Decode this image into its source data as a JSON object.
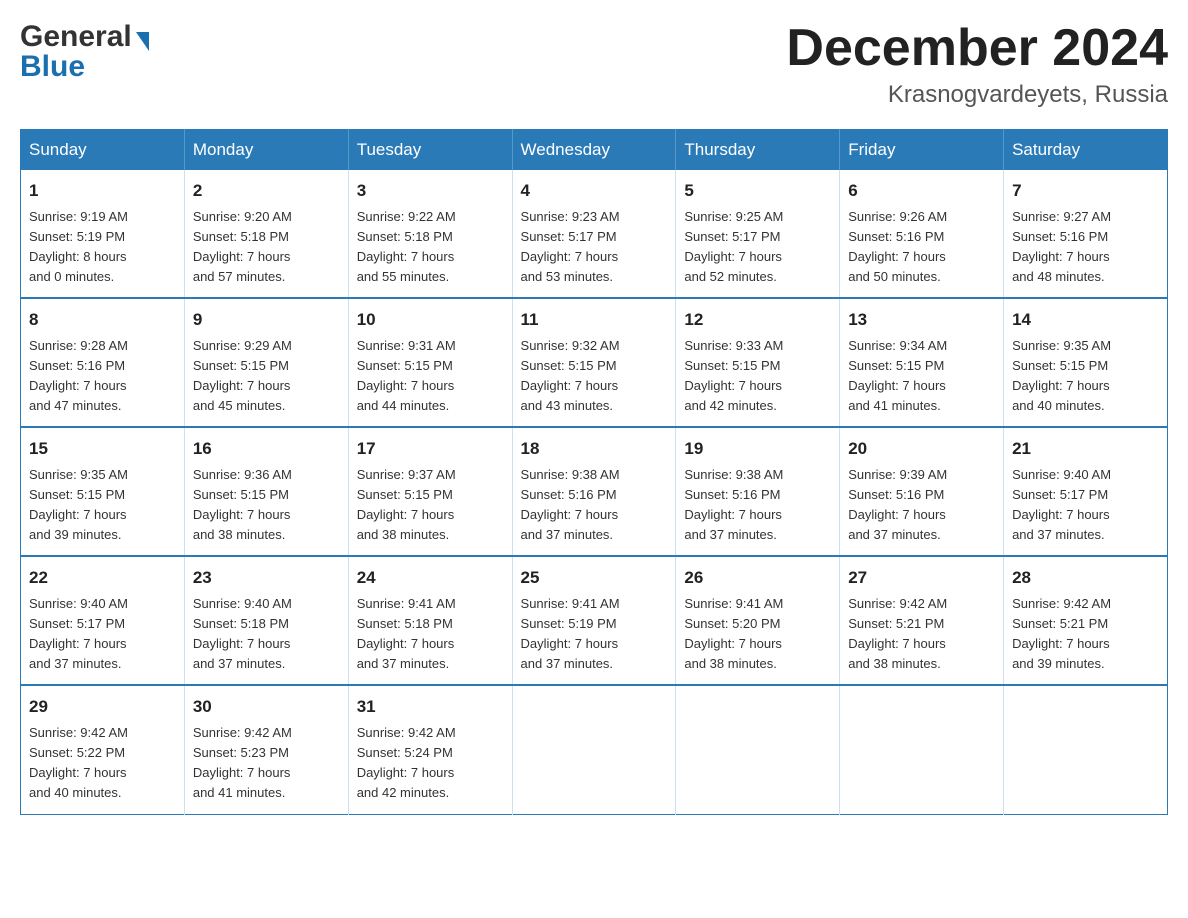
{
  "header": {
    "logo_general": "General",
    "logo_blue": "Blue",
    "title": "December 2024",
    "subtitle": "Krasnogvardeyets, Russia"
  },
  "weekdays": [
    "Sunday",
    "Monday",
    "Tuesday",
    "Wednesday",
    "Thursday",
    "Friday",
    "Saturday"
  ],
  "weeks": [
    [
      {
        "day": "1",
        "info": "Sunrise: 9:19 AM\nSunset: 5:19 PM\nDaylight: 8 hours\nand 0 minutes."
      },
      {
        "day": "2",
        "info": "Sunrise: 9:20 AM\nSunset: 5:18 PM\nDaylight: 7 hours\nand 57 minutes."
      },
      {
        "day": "3",
        "info": "Sunrise: 9:22 AM\nSunset: 5:18 PM\nDaylight: 7 hours\nand 55 minutes."
      },
      {
        "day": "4",
        "info": "Sunrise: 9:23 AM\nSunset: 5:17 PM\nDaylight: 7 hours\nand 53 minutes."
      },
      {
        "day": "5",
        "info": "Sunrise: 9:25 AM\nSunset: 5:17 PM\nDaylight: 7 hours\nand 52 minutes."
      },
      {
        "day": "6",
        "info": "Sunrise: 9:26 AM\nSunset: 5:16 PM\nDaylight: 7 hours\nand 50 minutes."
      },
      {
        "day": "7",
        "info": "Sunrise: 9:27 AM\nSunset: 5:16 PM\nDaylight: 7 hours\nand 48 minutes."
      }
    ],
    [
      {
        "day": "8",
        "info": "Sunrise: 9:28 AM\nSunset: 5:16 PM\nDaylight: 7 hours\nand 47 minutes."
      },
      {
        "day": "9",
        "info": "Sunrise: 9:29 AM\nSunset: 5:15 PM\nDaylight: 7 hours\nand 45 minutes."
      },
      {
        "day": "10",
        "info": "Sunrise: 9:31 AM\nSunset: 5:15 PM\nDaylight: 7 hours\nand 44 minutes."
      },
      {
        "day": "11",
        "info": "Sunrise: 9:32 AM\nSunset: 5:15 PM\nDaylight: 7 hours\nand 43 minutes."
      },
      {
        "day": "12",
        "info": "Sunrise: 9:33 AM\nSunset: 5:15 PM\nDaylight: 7 hours\nand 42 minutes."
      },
      {
        "day": "13",
        "info": "Sunrise: 9:34 AM\nSunset: 5:15 PM\nDaylight: 7 hours\nand 41 minutes."
      },
      {
        "day": "14",
        "info": "Sunrise: 9:35 AM\nSunset: 5:15 PM\nDaylight: 7 hours\nand 40 minutes."
      }
    ],
    [
      {
        "day": "15",
        "info": "Sunrise: 9:35 AM\nSunset: 5:15 PM\nDaylight: 7 hours\nand 39 minutes."
      },
      {
        "day": "16",
        "info": "Sunrise: 9:36 AM\nSunset: 5:15 PM\nDaylight: 7 hours\nand 38 minutes."
      },
      {
        "day": "17",
        "info": "Sunrise: 9:37 AM\nSunset: 5:15 PM\nDaylight: 7 hours\nand 38 minutes."
      },
      {
        "day": "18",
        "info": "Sunrise: 9:38 AM\nSunset: 5:16 PM\nDaylight: 7 hours\nand 37 minutes."
      },
      {
        "day": "19",
        "info": "Sunrise: 9:38 AM\nSunset: 5:16 PM\nDaylight: 7 hours\nand 37 minutes."
      },
      {
        "day": "20",
        "info": "Sunrise: 9:39 AM\nSunset: 5:16 PM\nDaylight: 7 hours\nand 37 minutes."
      },
      {
        "day": "21",
        "info": "Sunrise: 9:40 AM\nSunset: 5:17 PM\nDaylight: 7 hours\nand 37 minutes."
      }
    ],
    [
      {
        "day": "22",
        "info": "Sunrise: 9:40 AM\nSunset: 5:17 PM\nDaylight: 7 hours\nand 37 minutes."
      },
      {
        "day": "23",
        "info": "Sunrise: 9:40 AM\nSunset: 5:18 PM\nDaylight: 7 hours\nand 37 minutes."
      },
      {
        "day": "24",
        "info": "Sunrise: 9:41 AM\nSunset: 5:18 PM\nDaylight: 7 hours\nand 37 minutes."
      },
      {
        "day": "25",
        "info": "Sunrise: 9:41 AM\nSunset: 5:19 PM\nDaylight: 7 hours\nand 37 minutes."
      },
      {
        "day": "26",
        "info": "Sunrise: 9:41 AM\nSunset: 5:20 PM\nDaylight: 7 hours\nand 38 minutes."
      },
      {
        "day": "27",
        "info": "Sunrise: 9:42 AM\nSunset: 5:21 PM\nDaylight: 7 hours\nand 38 minutes."
      },
      {
        "day": "28",
        "info": "Sunrise: 9:42 AM\nSunset: 5:21 PM\nDaylight: 7 hours\nand 39 minutes."
      }
    ],
    [
      {
        "day": "29",
        "info": "Sunrise: 9:42 AM\nSunset: 5:22 PM\nDaylight: 7 hours\nand 40 minutes."
      },
      {
        "day": "30",
        "info": "Sunrise: 9:42 AM\nSunset: 5:23 PM\nDaylight: 7 hours\nand 41 minutes."
      },
      {
        "day": "31",
        "info": "Sunrise: 9:42 AM\nSunset: 5:24 PM\nDaylight: 7 hours\nand 42 minutes."
      },
      {
        "day": "",
        "info": ""
      },
      {
        "day": "",
        "info": ""
      },
      {
        "day": "",
        "info": ""
      },
      {
        "day": "",
        "info": ""
      }
    ]
  ]
}
